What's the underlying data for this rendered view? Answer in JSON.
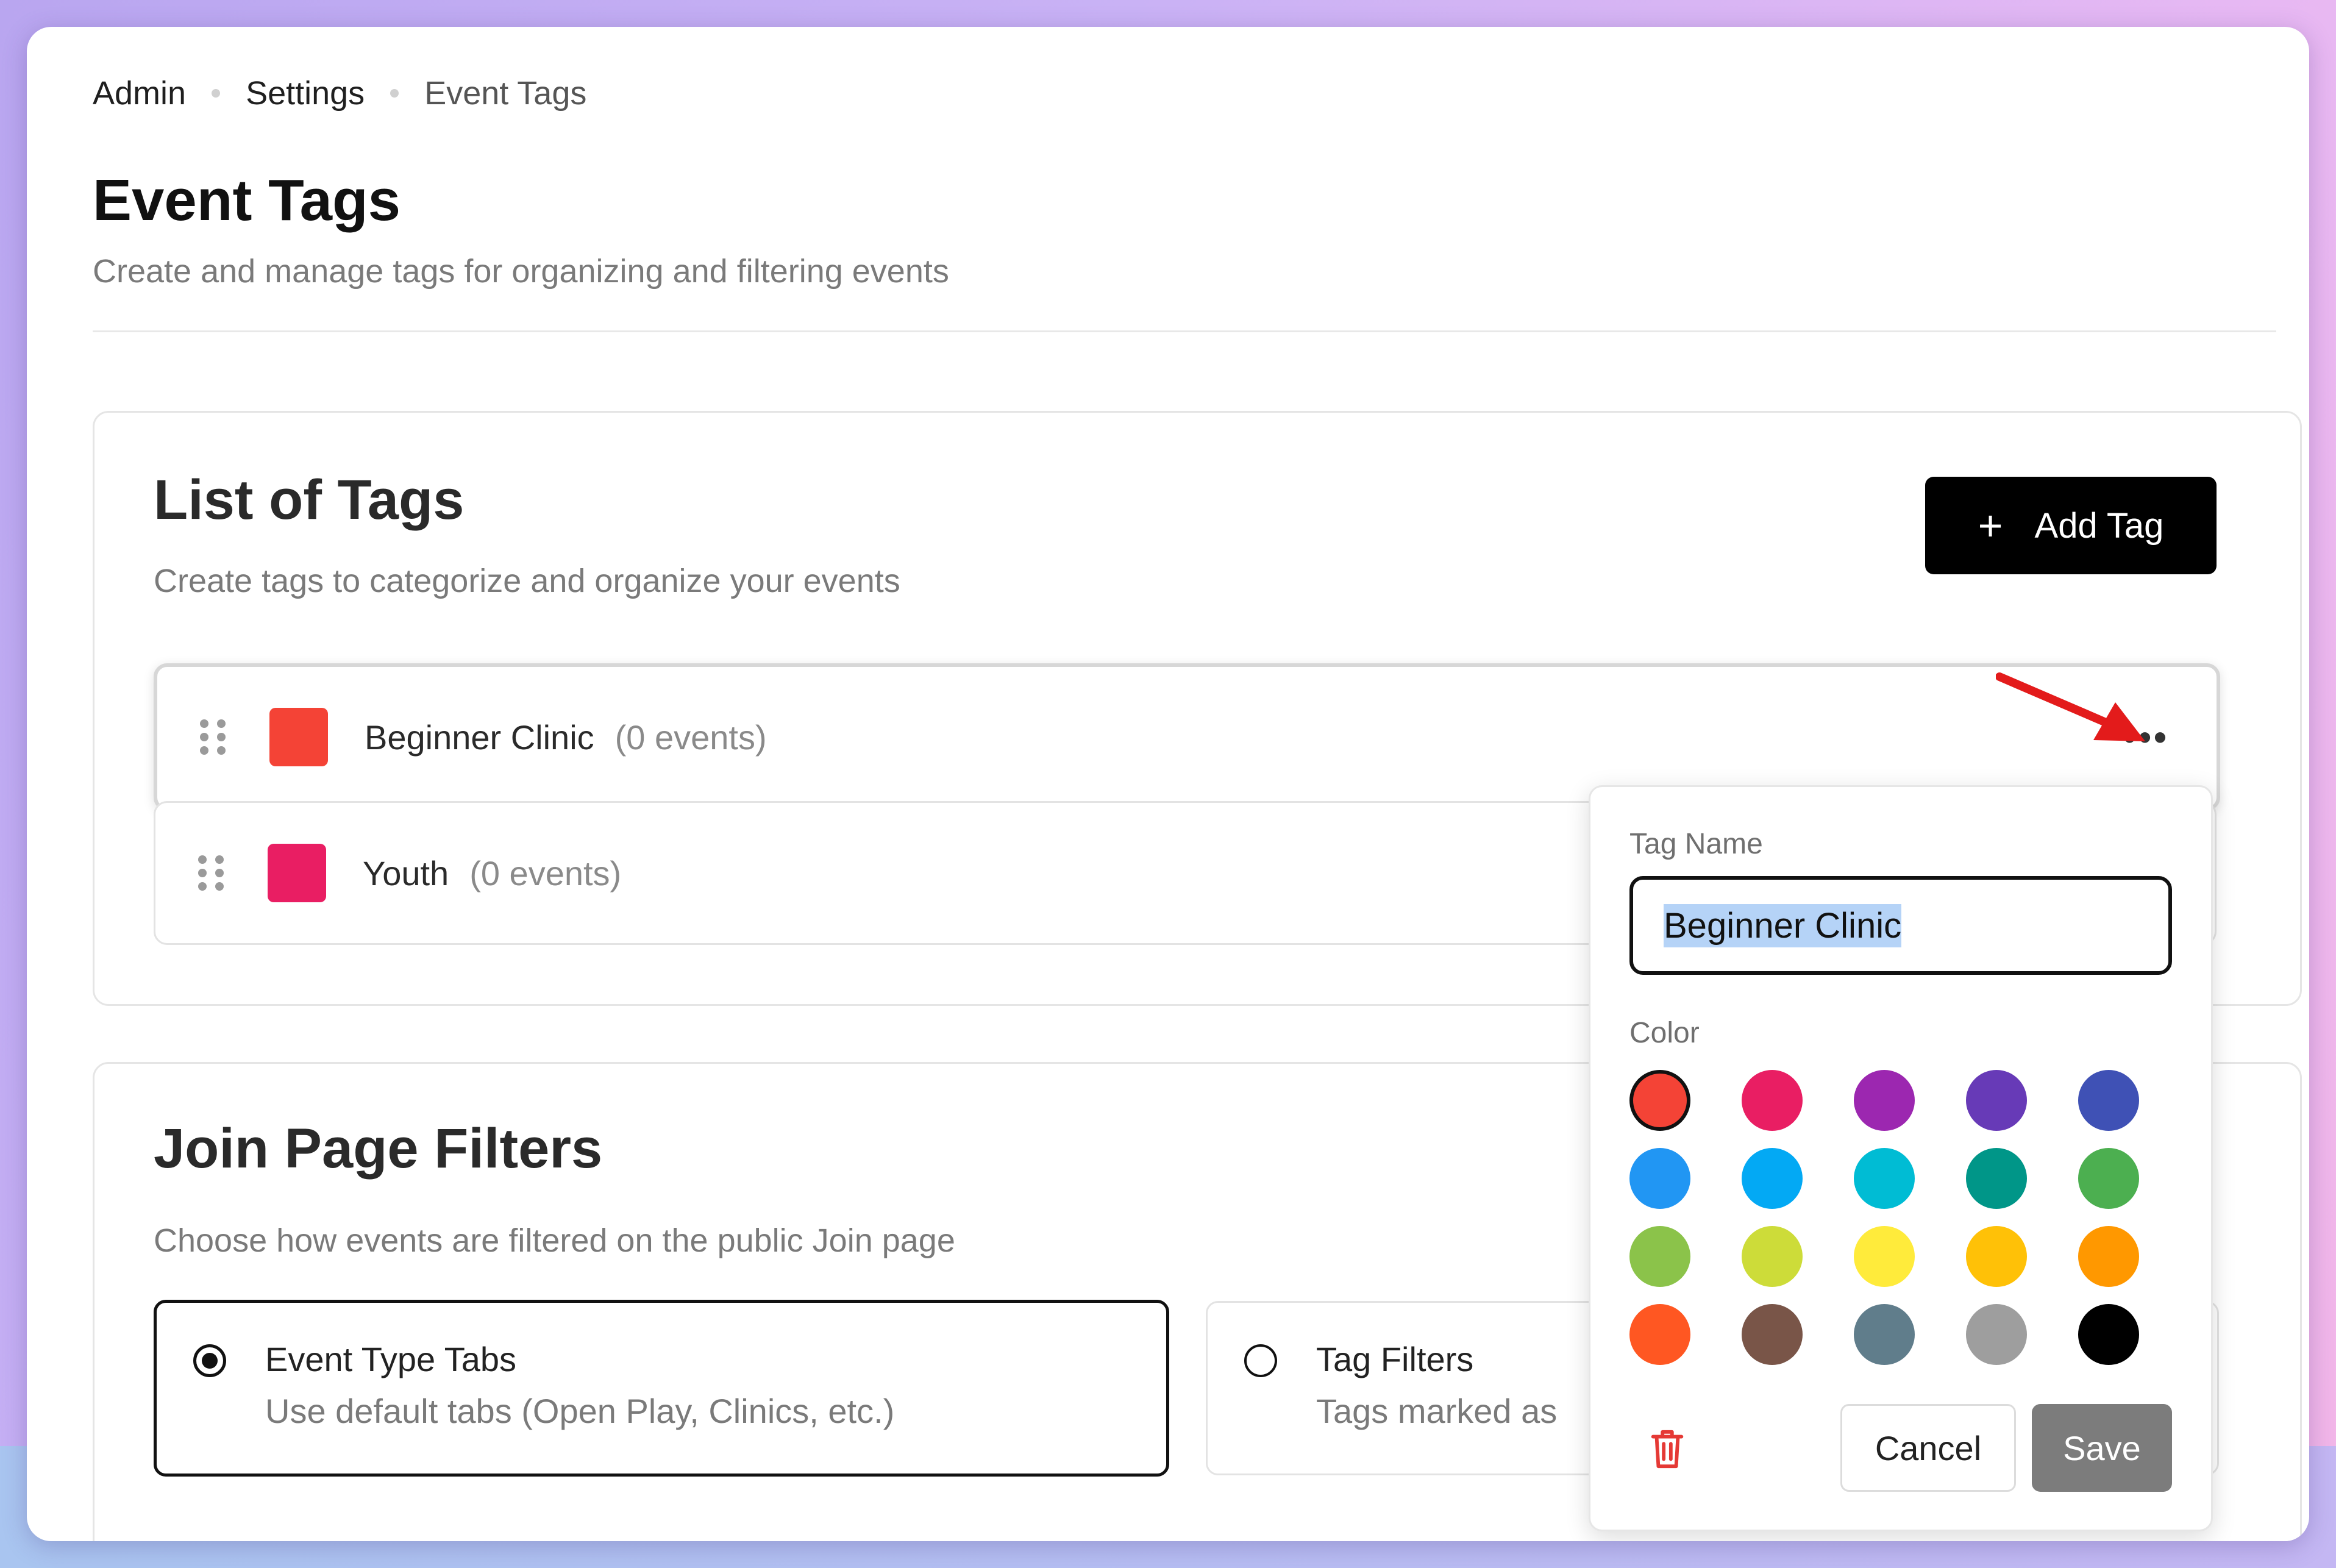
{
  "breadcrumb": {
    "item1": "Admin",
    "item2": "Settings",
    "item3": "Event Tags"
  },
  "page": {
    "title": "Event Tags",
    "subtitle": "Create and manage tags for organizing and filtering events"
  },
  "tags_section": {
    "title": "List of Tags",
    "subtitle": "Create tags to categorize and organize your events",
    "add_button": "Add Tag",
    "tags": [
      {
        "name": "Beginner Clinic",
        "count": "(0 events)",
        "color": "#f44336"
      },
      {
        "name": "Youth",
        "count": "(0 events)",
        "color": "#e91e63"
      }
    ],
    "more_label": "•••"
  },
  "filters_section": {
    "title": "Join Page Filters",
    "subtitle": "Choose how events are filtered on the public Join page",
    "options": [
      {
        "title": "Event Type Tabs",
        "desc": "Use default tabs (Open Play, Clinics, etc.)",
        "selected": true
      },
      {
        "title": "Tag Filters",
        "desc": "Tags marked as",
        "selected": false
      }
    ]
  },
  "popover": {
    "tag_name_label": "Tag Name",
    "tag_name_value": "Beginner Clinic",
    "color_label": "Color",
    "colors": [
      "#f44336",
      "#e91e63",
      "#9c27b0",
      "#673ab7",
      "#3f51b5",
      "#2196f3",
      "#03a9f4",
      "#00bcd4",
      "#009688",
      "#4caf50",
      "#8bc34a",
      "#cddc39",
      "#ffeb3b",
      "#ffc107",
      "#ff9800",
      "#ff5722",
      "#795548",
      "#607d8b",
      "#9e9e9e",
      "#000000"
    ],
    "selected_color": "#f44336",
    "cancel_label": "Cancel",
    "save_label": "Save"
  }
}
